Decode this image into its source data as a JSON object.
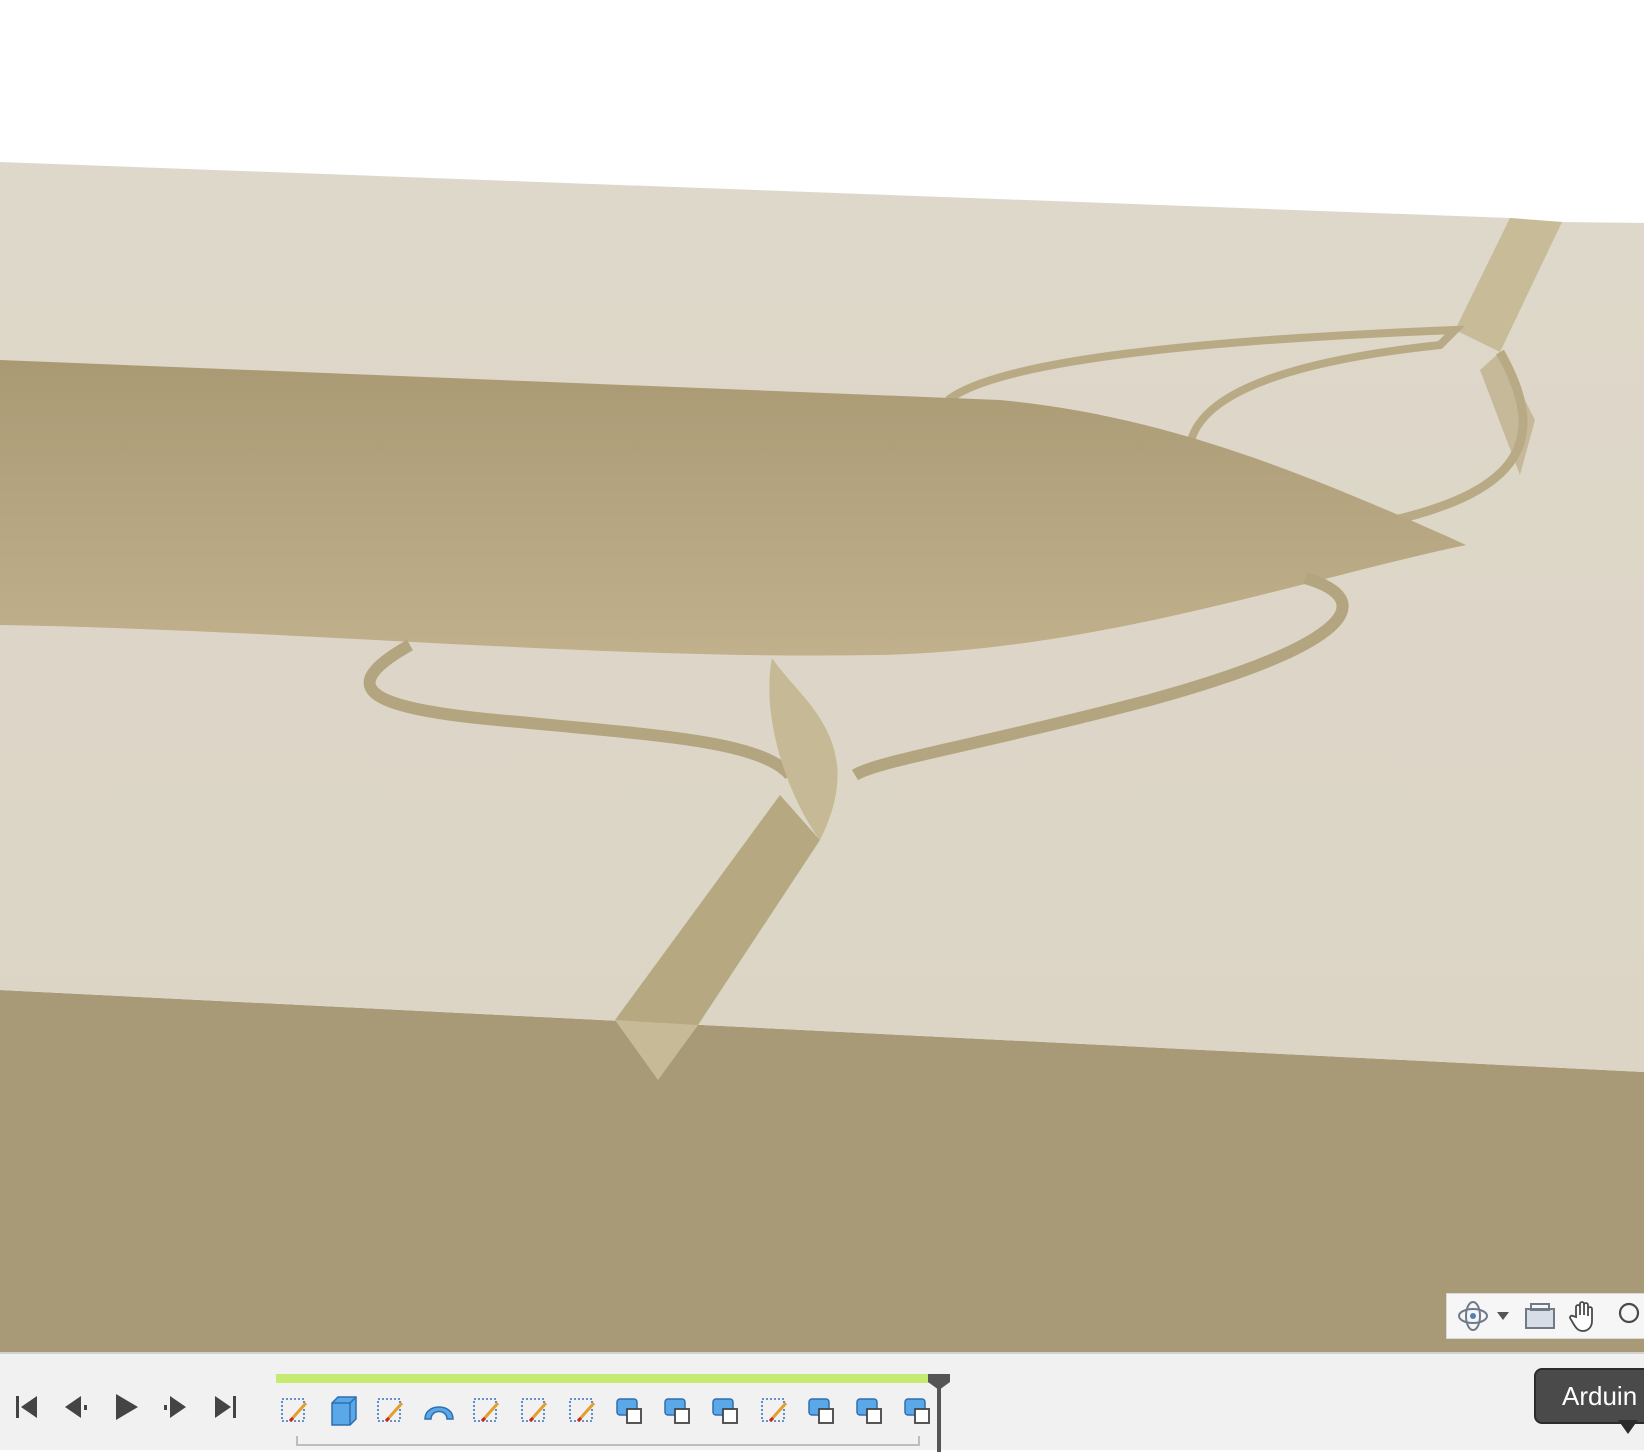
{
  "viewport": {
    "colors": {
      "background": "#ffffff",
      "plate_top": "#ddd7c9",
      "plate_side": "#a89a76",
      "channel": "#b8aa84",
      "channel_shadow": "#a2936d"
    }
  },
  "navigation_toolbar": {
    "items": [
      {
        "icon": "orbit-icon",
        "has_dropdown": true
      },
      {
        "icon": "look-at-icon"
      },
      {
        "icon": "pan-hand-icon"
      },
      {
        "icon": "zoom-icon"
      }
    ]
  },
  "timeline": {
    "playback": [
      "go-to-start-icon",
      "step-back-icon",
      "play-icon",
      "step-forward-icon",
      "go-to-end-icon"
    ],
    "progress_color": "#c4ec72",
    "features": [
      {
        "icon": "sketch-icon",
        "type": "sketch"
      },
      {
        "icon": "extrude-icon",
        "type": "extrude"
      },
      {
        "icon": "sketch-icon",
        "type": "sketch"
      },
      {
        "icon": "sweep-icon",
        "type": "sweep"
      },
      {
        "icon": "sketch-icon",
        "type": "sketch"
      },
      {
        "icon": "sketch-icon",
        "type": "sketch"
      },
      {
        "icon": "sketch-icon",
        "type": "sketch"
      },
      {
        "icon": "combine-icon",
        "type": "combine"
      },
      {
        "icon": "combine-icon",
        "type": "combine"
      },
      {
        "icon": "combine-icon",
        "type": "combine"
      },
      {
        "icon": "sketch-icon",
        "type": "sketch"
      },
      {
        "icon": "combine-icon",
        "type": "combine"
      },
      {
        "icon": "combine-icon",
        "type": "combine"
      },
      {
        "icon": "combine-icon",
        "type": "combine"
      }
    ]
  },
  "tooltip": {
    "text": "Arduin"
  }
}
